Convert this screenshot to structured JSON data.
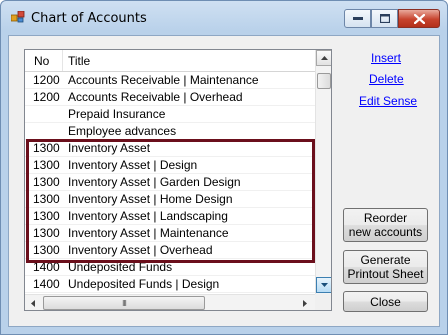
{
  "window": {
    "title": "Chart of Accounts"
  },
  "list": {
    "columns": {
      "no": "No",
      "title": "Title"
    },
    "rows": [
      {
        "no": "1200",
        "title": "Accounts Receivable | Maintenance"
      },
      {
        "no": "1200",
        "title": "Accounts Receivable | Overhead"
      },
      {
        "no": "",
        "title": "Prepaid Insurance"
      },
      {
        "no": "",
        "title": "Employee advances"
      },
      {
        "no": "1300",
        "title": "Inventory Asset"
      },
      {
        "no": "1300",
        "title": "Inventory Asset | Design"
      },
      {
        "no": "1300",
        "title": "Inventory Asset | Garden Design"
      },
      {
        "no": "1300",
        "title": "Inventory Asset | Home Design"
      },
      {
        "no": "1300",
        "title": "Inventory Asset | Landscaping"
      },
      {
        "no": "1300",
        "title": "Inventory Asset | Maintenance"
      },
      {
        "no": "1300",
        "title": "Inventory Asset | Overhead"
      },
      {
        "no": "1400",
        "title": "Undeposited Funds"
      },
      {
        "no": "1400",
        "title": "Undeposited Funds | Design"
      }
    ],
    "hscroll_grip": "III"
  },
  "actions": {
    "insert": "Insert",
    "delete": "Delete",
    "edit_sense": "Edit Sense"
  },
  "buttons": {
    "reorder_line1": "Reorder",
    "reorder_line2": "new accounts",
    "generate_line1": "Generate",
    "generate_line2": "Printout Sheet",
    "close": "Close"
  },
  "colors": {
    "highlight_border": "#6b0f1c",
    "link": "#0000ff",
    "title_bar": "#b9d1ea"
  }
}
